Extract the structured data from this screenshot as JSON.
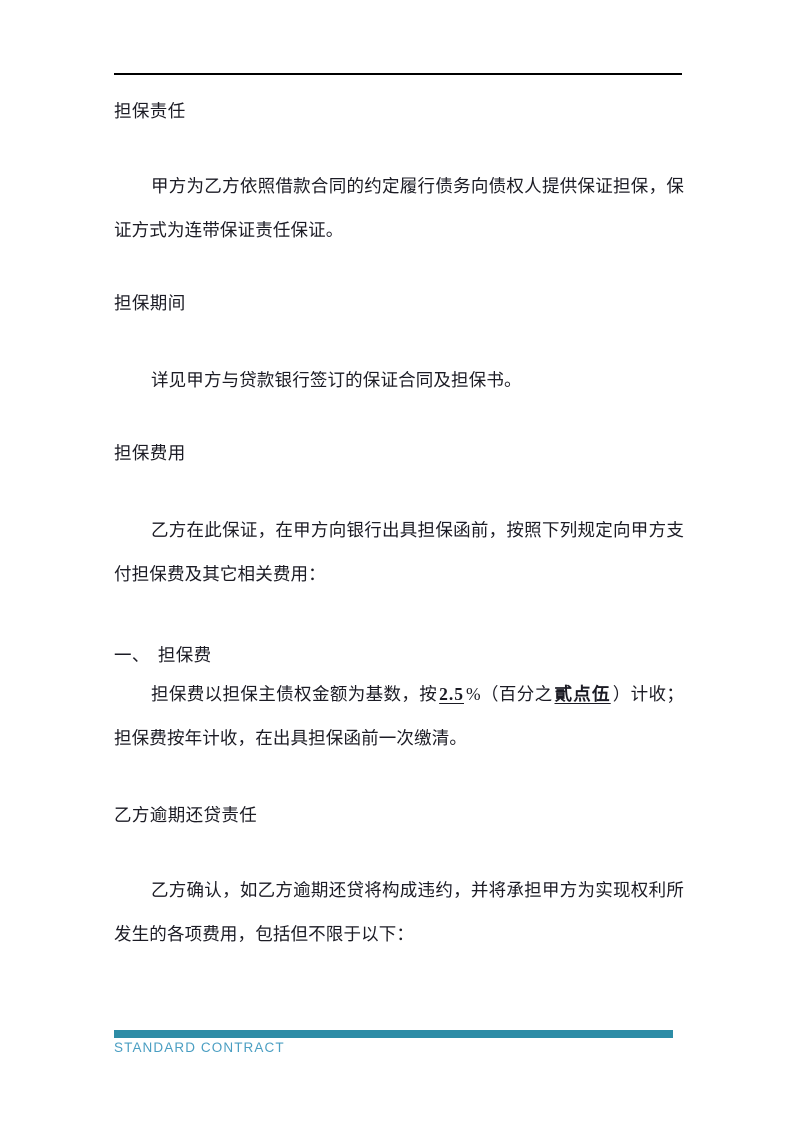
{
  "document": {
    "sections": [
      {
        "heading": "担保责任",
        "paragraphs": [
          "甲方为乙方依照借款合同的约定履行债务向债权人提供保证担保，保证方式为连带保证责任保证。"
        ]
      },
      {
        "heading": "担保期间",
        "paragraphs": [
          "详见甲方与贷款银行签订的保证合同及担保书。"
        ]
      },
      {
        "heading": "担保费用",
        "paragraphs": [
          "乙方在此保证，在甲方向银行出具担保函前，按照下列规定向甲方支付担保费及其它相关费用："
        ]
      }
    ],
    "clause_one": {
      "number_label": "一、",
      "title": "担保费",
      "text_before_rate": "担保费以担保主债权金额为基数，按",
      "rate_value": "2.5",
      "percent_sign": "%",
      "paren_open": "（百分之",
      "rate_in_words": "貳点伍",
      "paren_close": "）",
      "text_after_rate": "计收；担保费按年计收，在出具担保函前一次缴清。"
    },
    "section_overdue": {
      "heading": "乙方逾期还贷责任",
      "paragraphs": [
        "乙方确认，如乙方逾期还贷将构成违约，并将承担甲方为实现权利所发生的各项费用，包括但不限于以下："
      ]
    }
  },
  "footer": {
    "label": "STANDARD CONTRACT",
    "bar_color": "#2d8ca6",
    "text_color": "#4a9ec2"
  }
}
